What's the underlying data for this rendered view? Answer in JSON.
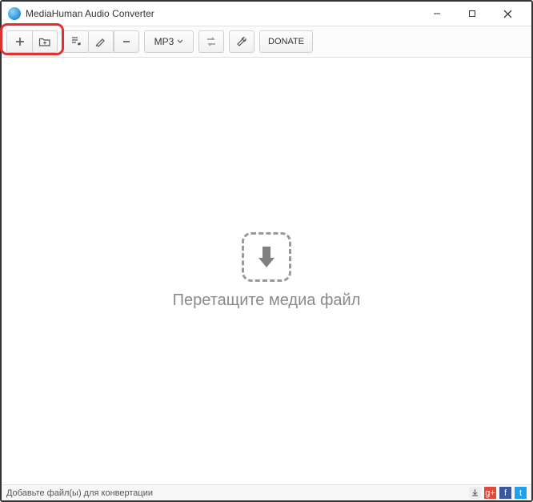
{
  "window": {
    "title": "MediaHuman Audio Converter"
  },
  "toolbar": {
    "format_label": "MP3",
    "donate_label": "DONATE"
  },
  "content": {
    "drop_message": "Перетащите медиа файл"
  },
  "statusbar": {
    "message": "Добавьте файл(ы) для конвертации"
  },
  "icons": {
    "gplus": "g+",
    "facebook": "f",
    "twitter": "t"
  }
}
